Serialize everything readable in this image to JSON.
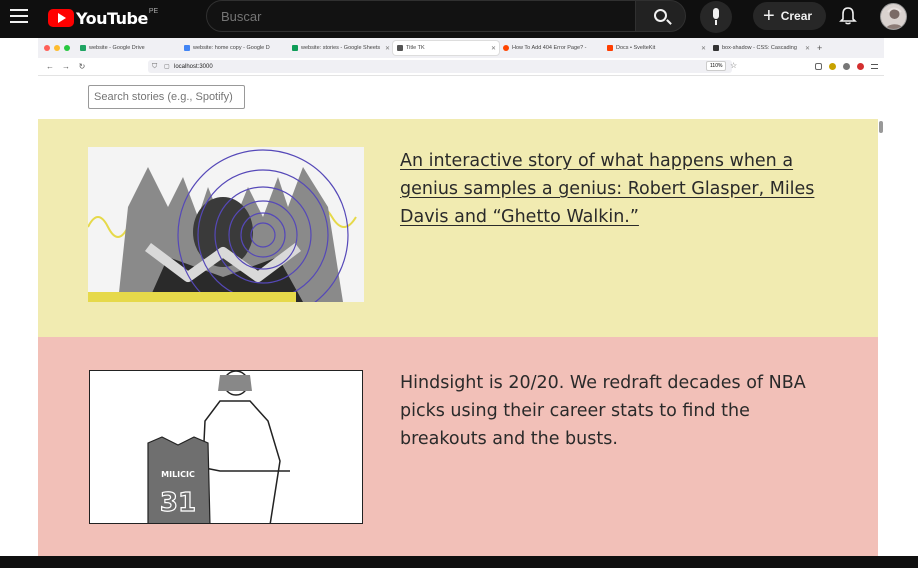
{
  "youtube": {
    "logo_text": "YouTube",
    "region_code": "PE",
    "search_placeholder": "Buscar",
    "create_label": "Crear",
    "icons": [
      "menu-icon",
      "search-icon",
      "mic-icon",
      "create-plus-icon",
      "bell-icon"
    ]
  },
  "browser": {
    "tabs": [
      {
        "label": "website - Google Drive",
        "fav_color": "#1fa463"
      },
      {
        "label": "website: home copy - Google D",
        "fav_color": "#4285f4"
      },
      {
        "label": "website: stories - Google Sheets",
        "fav_color": "#0f9d58"
      },
      {
        "label": "Title TK",
        "fav_color": "#555555",
        "active": true
      },
      {
        "label": "How To Add 404 Error Page? - ",
        "fav_color": "#ff4500"
      },
      {
        "label": "Docs • SvelteKit",
        "fav_color": "#ff3e00"
      },
      {
        "label": "box-shadow - CSS: Cascading",
        "fav_color": "#333333"
      }
    ],
    "url": "localhost:3000",
    "zoom": "110%"
  },
  "page": {
    "search_placeholder": "Search stories (e.g., Spotify)",
    "stories": [
      {
        "title": "An interactive story of what happens when a genius samples a genius: Robert Glasper, Miles Davis and “Ghetto Walkin.”",
        "bg": "#f1ebb1"
      },
      {
        "title": "Hindsight is 20/20. We redraft decades of NBA picks using their career stats to find the breakouts and the busts.",
        "bg": "#f2c0b8",
        "jersey_name": "MILICIC",
        "jersey_number": "31"
      }
    ]
  }
}
